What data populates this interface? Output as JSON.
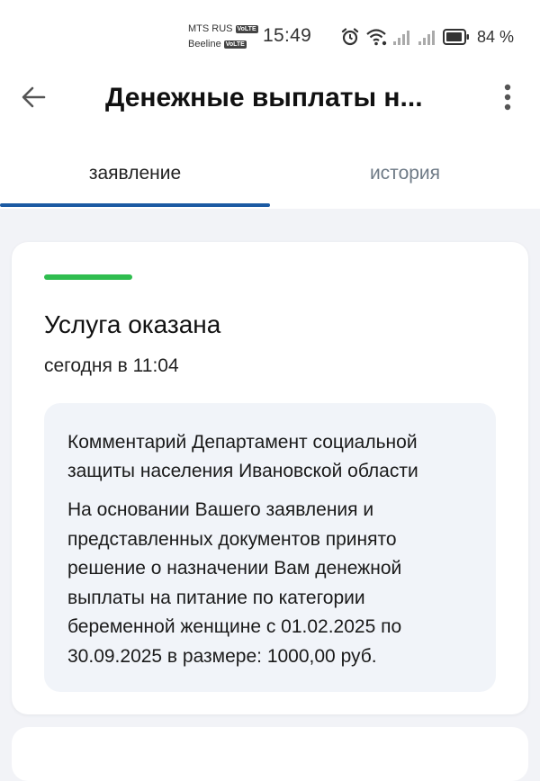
{
  "status_bar": {
    "carrier1": "MTS RUS",
    "carrier2": "Beeline",
    "volte": "VoLTE",
    "time": "15:49",
    "battery": "84 %"
  },
  "appbar": {
    "title": "Денежные выплаты н..."
  },
  "tabs": [
    {
      "label": "заявление",
      "active": true
    },
    {
      "label": "история",
      "active": false
    }
  ],
  "application": {
    "status_color": "#2fbd4f",
    "status": "Услуга оказана",
    "time": "сегодня в 11:04",
    "comment_title": "Комментарий Департамент социальной защиты населения Ивановской области",
    "comment_text": "На основании Вашего заявления и представленных документов принято решение о назначении Вам денежной выплаты на питание по категории беременной женщине с 01.02.2025 по 30.09.2025 в размере: 1000,00 руб."
  },
  "colors": {
    "accent": "#1b5aa3",
    "success": "#2fbd4f"
  },
  "icons": [
    "back-arrow-icon",
    "more-vertical-icon",
    "alarm-icon",
    "wifi-icon",
    "signal-icon",
    "battery-icon"
  ]
}
